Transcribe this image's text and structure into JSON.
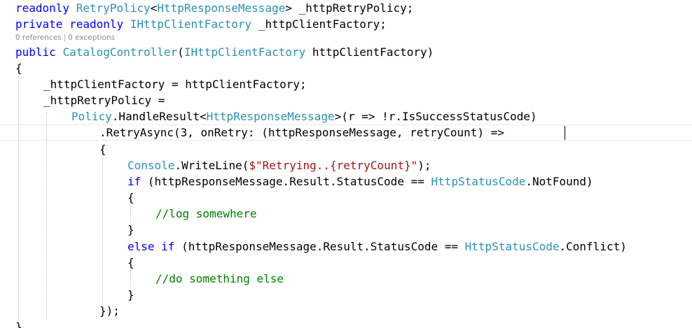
{
  "editor": {
    "code_lens": {
      "references": "0 references",
      "exceptions": "0 exceptions"
    },
    "lines": {
      "l1": {
        "kw_readonly": "readonly",
        "type_retrypolicy": "RetryPolicy",
        "lt": "<",
        "type_httpresponsemessage": "HttpResponseMessage",
        "rest": "> _httpRetryPolicy;"
      },
      "l2": {
        "kw_private": "private",
        "kw_readonly": "readonly",
        "type_ihttpclientfactory": "IHttpClientFactory",
        "rest": " _httpClientFactory;"
      },
      "l3": {
        "kw_public": "public",
        "type_catalogcontroller": "CatalogController",
        "paren": "(",
        "type_ihttpclientfactory": "IHttpClientFactory",
        "rest": " httpClientFactory)"
      },
      "l4": {
        "text": "{"
      },
      "l5": {
        "text": "_httpClientFactory = httpClientFactory;"
      },
      "l6": {
        "text": "_httpRetryPolicy ="
      },
      "l7": {
        "type_policy": "Policy",
        "dot_method": ".HandleResult<",
        "type_httpresponsemessage": "HttpResponseMessage",
        "rest": ">(r => !r.IsSuccessStatusCode)"
      },
      "l8": {
        "text": ".RetryAsync(3, onRetry: (httpResponseMessage, retryCount) =>"
      },
      "l9": {
        "text": "{"
      },
      "l10": {
        "type_console": "Console",
        "method": ".WriteLine(",
        "string": "$\"Retrying..{retryCount}\"",
        "rest": ");"
      },
      "l11": {
        "kw_if": "if",
        "middle": " (httpResponseMessage.Result.StatusCode == ",
        "type_httpstatuscode": "HttpStatusCode",
        "rest": ".NotFound)"
      },
      "l12": {
        "text": "{"
      },
      "l13": {
        "comment": "//log somewhere"
      },
      "l14": {
        "text": "}"
      },
      "l15": {
        "kw_else_if": "else if",
        "middle": " (httpResponseMessage.Result.StatusCode == ",
        "type_httpstatuscode": "HttpStatusCode",
        "rest": ".Conflict)"
      },
      "l16": {
        "text": "{"
      },
      "l17": {
        "comment": "//do something else"
      },
      "l18": {
        "text": "}"
      },
      "l19": {
        "text": "});"
      },
      "l20": {
        "text": "}"
      }
    }
  }
}
